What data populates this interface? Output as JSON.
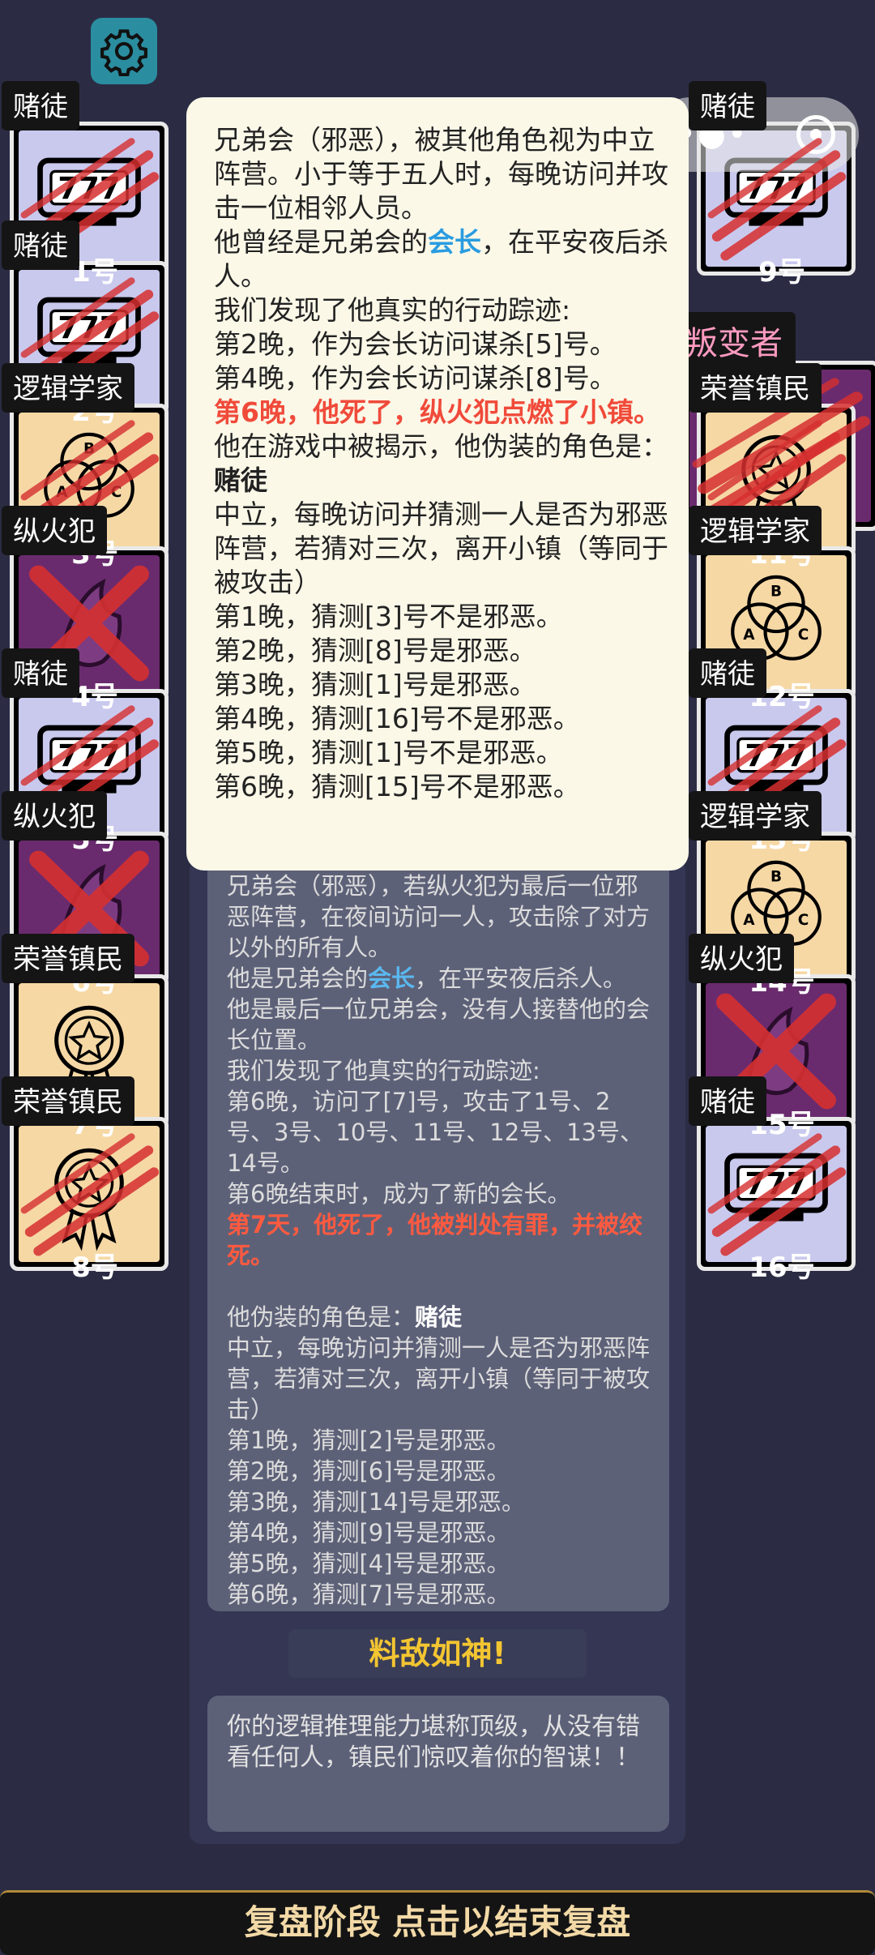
{
  "colors": {
    "background": "#2b2c44",
    "gambler": "#c9c9ee",
    "logician": "#f6d8a5",
    "arsonist": "#6a2b6e",
    "traitor": "#6a2b6e",
    "claw": "#d63030",
    "highlight_blue": "#2a9ce0",
    "highlight_red": "#f04a3a",
    "verdict_gold": "#f3c531"
  },
  "players": [
    {
      "num": "1号",
      "role": "赌徒",
      "art": "slot",
      "dead": "claw"
    },
    {
      "num": "2号",
      "role": "赌徒",
      "art": "slot",
      "dead": "claw"
    },
    {
      "num": "3号",
      "role": "逻辑学家",
      "art": "venn",
      "dead": "claw"
    },
    {
      "num": "4号",
      "role": "纵火犯",
      "art": "fire",
      "dead": "x"
    },
    {
      "num": "5号",
      "role": "赌徒",
      "art": "slot",
      "dead": "claw"
    },
    {
      "num": "6号",
      "role": "纵火犯",
      "art": "fire",
      "dead": "x"
    },
    {
      "num": "7号",
      "role": "荣誉镇民",
      "art": "medal",
      "dead": "none"
    },
    {
      "num": "8号",
      "role": "荣誉镇民",
      "art": "medal",
      "dead": "claw"
    },
    {
      "num": "9号",
      "role": "赌徒",
      "art": "slot",
      "dead": "claw"
    },
    {
      "num": "10号",
      "role": "叛变者",
      "art": "mask",
      "dead": "claw"
    },
    {
      "num": "11号",
      "role": "荣誉镇民",
      "art": "medal",
      "dead": "claw"
    },
    {
      "num": "12号",
      "role": "逻辑学家",
      "art": "venn",
      "dead": "none"
    },
    {
      "num": "13号",
      "role": "赌徒",
      "art": "slot",
      "dead": "claw"
    },
    {
      "num": "14号",
      "role": "逻辑学家",
      "art": "venn",
      "dead": "none"
    },
    {
      "num": "15号",
      "role": "纵火犯",
      "art": "fire",
      "dead": "x"
    },
    {
      "num": "16号",
      "role": "赌徒",
      "art": "slot",
      "dead": "claw"
    }
  ],
  "popup": {
    "line1": "兄弟会（邪恶），被其他角色视为中立阵营。小于等于五人时，每晚访问并攻击一位相邻人员。",
    "line2_a": "他曾经是兄弟会的",
    "line2_hl": "会长",
    "line2_b": "，在平安夜后杀人。",
    "line3": "我们发现了他真实的行动踪迹:",
    "line4": "第2晚，作为会长访问谋杀[5]号。",
    "line5": "第4晚，作为会长访问谋杀[8]号。",
    "line6": "第6晚，他死了，纵火犯点燃了小镇。",
    "line7": "他在游戏中被揭示，他伪装的角色是：",
    "line7_role": "赌徒",
    "line8": "中立，每晚访问并猜测一人是否为邪恶阵营，若猜对三次，离开小镇（等同于被攻击）",
    "guesses": [
      "第1晚，猜测[3]号不是邪恶。",
      "第2晚，猜测[8]号是邪恶。",
      "第3晚，猜测[1]号是邪恶。",
      "第4晚，猜测[16]号不是邪恶。",
      "第5晚，猜测[1]号不是邪恶。",
      "第6晚，猜测[15]号不是邪恶。"
    ]
  },
  "panel": {
    "line1": "兄弟会（邪恶），若纵火犯为最后一位邪恶阵营，在夜间访问一人，攻击除了对方以外的所有人。",
    "line2_a": "他是兄弟会的",
    "line2_hl": "会长",
    "line2_b": "，在平安夜后杀人。他是最后一位兄弟会，没有人接替他的会长位置。",
    "line3": "我们发现了他真实的行动踪迹:",
    "line4": "第6晚，访问了[7]号，攻击了1号、2号、3号、10号、11号、12号、13号、14号。",
    "line5": "第6晚结束时，成为了新的会长。",
    "line6": "第7天，他死了，他被判处有罪，并被绞死。",
    "line7": "他伪装的角色是：",
    "line7_role": "赌徒",
    "line8": "中立，每晚访问并猜测一人是否为邪恶阵营，若猜对三次，离开小镇（等同于被攻击）",
    "guesses": [
      "第1晚，猜测[2]号是邪恶。",
      "第2晚，猜测[6]号是邪恶。",
      "第3晚，猜测[14]号是邪恶。",
      "第4晚，猜测[9]号是邪恶。",
      "第5晚，猜测[4]号是邪恶。",
      "第6晚，猜测[7]号是邪恶。"
    ]
  },
  "verdict": "料敌如神!",
  "summary": "你的逻辑推理能力堪称顶级，从没有错看任何人，镇民们惊叹着你的智谋！！",
  "bottom_bar": "复盘阶段 点击以结束复盘",
  "icons": {
    "settings": "gear-icon",
    "menu": "more-dots-icon",
    "close": "target-icon"
  }
}
